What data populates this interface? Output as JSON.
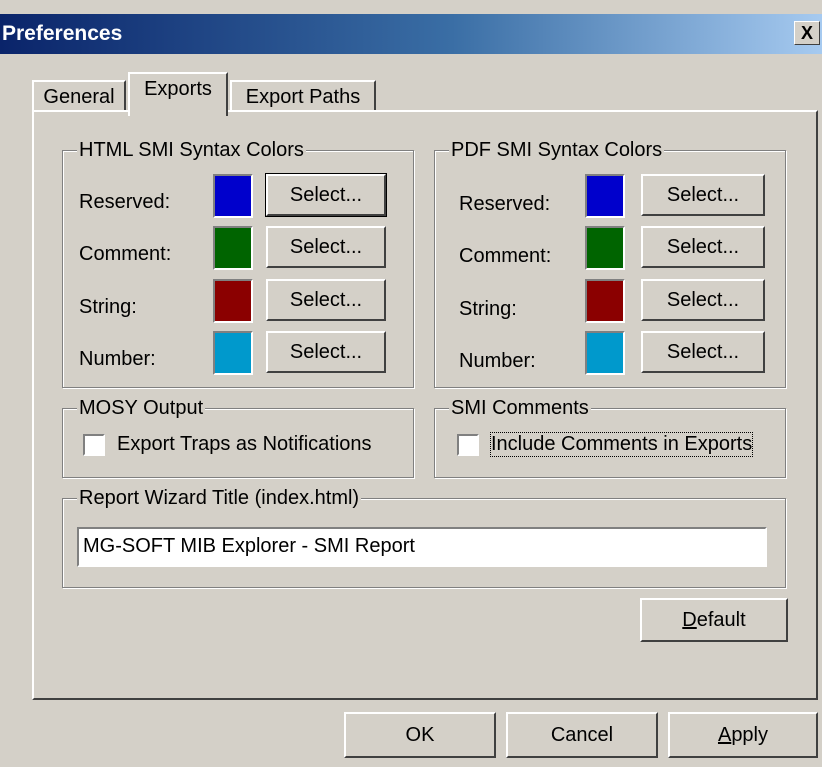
{
  "window": {
    "title": "Preferences",
    "close_label": "X"
  },
  "tabs": [
    {
      "label": "General",
      "active": false
    },
    {
      "label": "Exports",
      "active": true
    },
    {
      "label": "Export Paths",
      "active": false
    }
  ],
  "html_group": {
    "legend": "HTML SMI Syntax Colors",
    "rows": [
      {
        "label": "Reserved:",
        "color": "#0000cc",
        "button": "Select..."
      },
      {
        "label": "Comment:",
        "color": "#006400",
        "button": "Select..."
      },
      {
        "label": "String:",
        "color": "#8b0000",
        "button": "Select..."
      },
      {
        "label": "Number:",
        "color": "#0099cc",
        "button": "Select..."
      }
    ]
  },
  "pdf_group": {
    "legend": "PDF SMI Syntax Colors",
    "rows": [
      {
        "label": "Reserved:",
        "color": "#0000cc",
        "button": "Select..."
      },
      {
        "label": "Comment:",
        "color": "#006400",
        "button": "Select..."
      },
      {
        "label": "String:",
        "color": "#8b0000",
        "button": "Select..."
      },
      {
        "label": "Number:",
        "color": "#0099cc",
        "button": "Select..."
      }
    ]
  },
  "mosy": {
    "legend": "MOSY Output",
    "checkbox_label": "Export Traps as Notifications",
    "checked": false
  },
  "smi_comments": {
    "legend": "SMI Comments",
    "checkbox_label": "Include Comments in Exports",
    "checked": false
  },
  "report": {
    "legend": "Report Wizard Title (index.html)",
    "value": "MG-SOFT MIB Explorer - SMI Report"
  },
  "buttons": {
    "default_first": "D",
    "default_rest": "efault",
    "ok": "OK",
    "cancel": "Cancel",
    "apply_first": "A",
    "apply_rest": "pply"
  }
}
